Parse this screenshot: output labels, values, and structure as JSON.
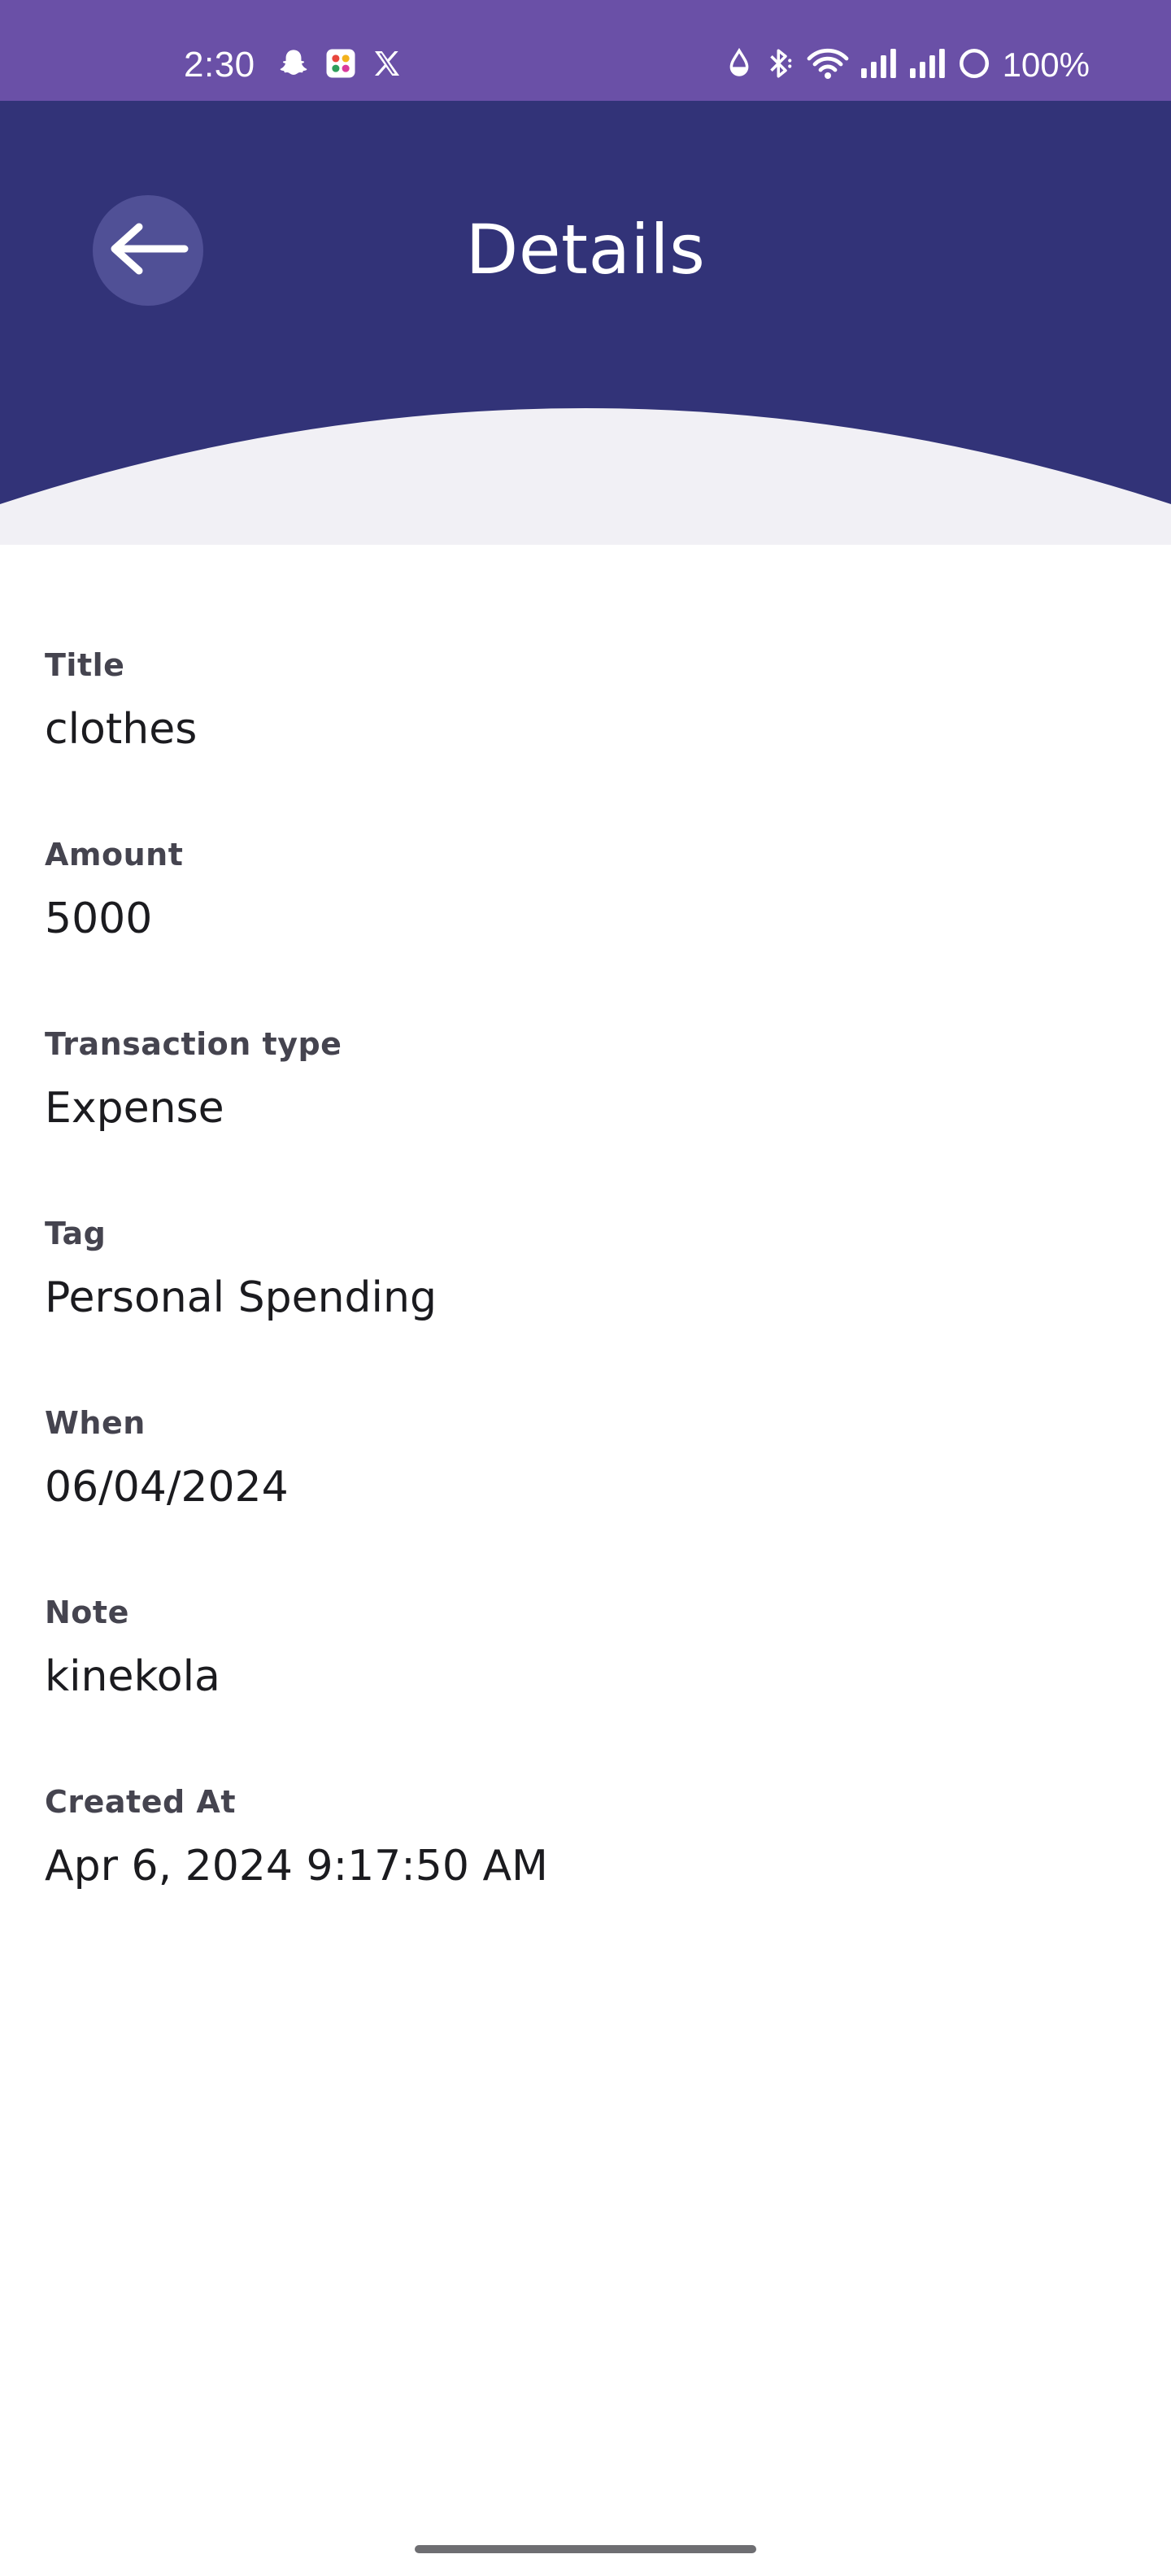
{
  "status_bar": {
    "time": "2:30",
    "battery": "100%",
    "background_color": "#6a50a7",
    "left_icons": [
      "snapchat-icon",
      "app-grid-icon",
      "x-icon"
    ],
    "right_icons": [
      "data-saver-icon",
      "bluetooth-icon",
      "wifi-icon",
      "signal-icon",
      "signal-icon",
      "battery-icon"
    ]
  },
  "header": {
    "title": "Details",
    "back_icon": "arrow-left-icon",
    "background_color": "#323378",
    "curve_color": "#f1f0f5"
  },
  "details": [
    {
      "label": "Title",
      "value": "clothes"
    },
    {
      "label": "Amount",
      "value": "5000"
    },
    {
      "label": "Transaction type",
      "value": "Expense"
    },
    {
      "label": "Tag",
      "value": "Personal Spending"
    },
    {
      "label": "When",
      "value": "06/04/2024"
    },
    {
      "label": "Note",
      "value": "kinekola"
    },
    {
      "label": "Created At",
      "value": "Apr 6, 2024 9:17:50 AM"
    }
  ]
}
